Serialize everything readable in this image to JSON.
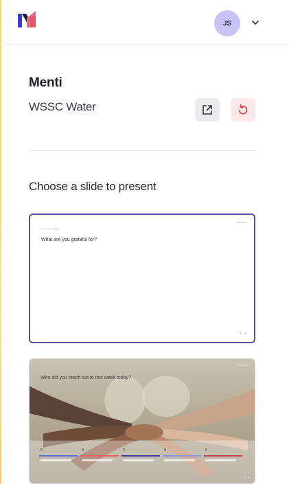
{
  "header": {
    "logo_icon": "menti-logo-icon",
    "avatar_initials": "JS",
    "avatar_color": "#c8c3f4",
    "menu_icon": "chevron-down-icon"
  },
  "app": {
    "title": "Menti",
    "subtitle": "WSSC Water",
    "open_icon": "open-external-icon",
    "reset_icon": "reset-icon"
  },
  "section": {
    "title": "Choose a slide to present"
  },
  "slides": [
    {
      "tag": "Mentimeter",
      "question": "What are you grateful for?",
      "dots": "• •",
      "selected": true
    },
    {
      "tag": "Mentimeter",
      "question": "Who did you reach out to this week today?",
      "dots": "• •",
      "bars": [
        {
          "num": "0",
          "color": "#5a6fd6"
        },
        {
          "num": "0",
          "color": "#e2645a"
        },
        {
          "num": "0",
          "color": "#3f3f9c"
        },
        {
          "num": "0",
          "color": "#8b95d8"
        },
        {
          "num": "0",
          "color": "#c4434a"
        }
      ]
    }
  ],
  "colors": {
    "accent": "#5a4ea8",
    "reset_bg": "#fbe9ea",
    "reset_fg": "#d84a52"
  }
}
